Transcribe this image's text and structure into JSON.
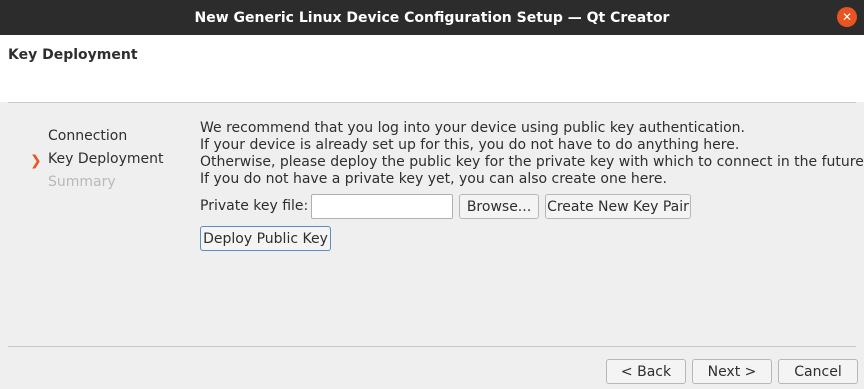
{
  "window": {
    "title": "New Generic Linux Device Configuration Setup — Qt Creator",
    "close_glyph": "✕"
  },
  "page": {
    "title": "Key Deployment"
  },
  "steps": [
    {
      "label": "Connection",
      "state": "done"
    },
    {
      "label": "Key Deployment",
      "state": "current"
    },
    {
      "label": "Summary",
      "state": "pending"
    }
  ],
  "current_step_marker": "❯",
  "description": [
    "We recommend that you log into your device using public key authentication.",
    "If your device is already set up for this, you do not have to do anything here.",
    "Otherwise, please deploy the public key for the private key with which to connect in the future.",
    "If you do not have a private key yet, you can also create one here."
  ],
  "private_key": {
    "label": "Private key file:",
    "value": "",
    "browse_label": "Browse...",
    "create_label": "Create New Key Pair"
  },
  "deploy_label": "Deploy Public Key",
  "nav": {
    "back_label": "< Back",
    "next_label": "Next >",
    "cancel_label": "Cancel"
  },
  "colors": {
    "accent": "#e95420",
    "titlebar": "#2c2c2c",
    "background": "#efefef"
  }
}
